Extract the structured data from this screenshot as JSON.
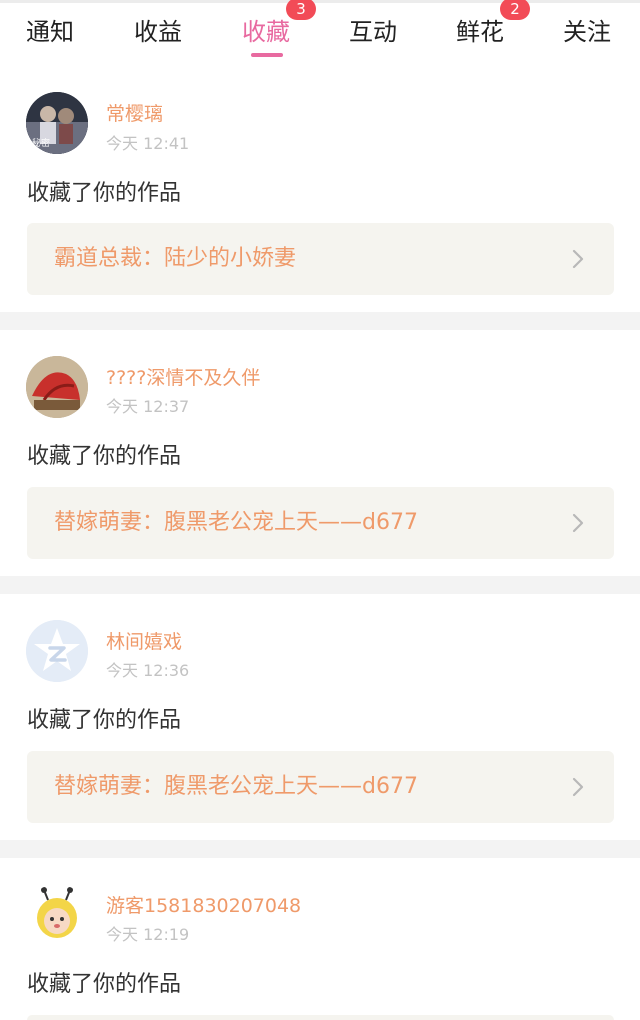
{
  "tabs": [
    {
      "label": "通知",
      "badge": null
    },
    {
      "label": "收益",
      "badge": null
    },
    {
      "label": "收藏",
      "badge": "3",
      "active": true
    },
    {
      "label": "互动",
      "badge": null
    },
    {
      "label": "鲜花",
      "badge": "2"
    },
    {
      "label": "关注",
      "badge": null
    }
  ],
  "accent_color": "#e86aa0",
  "badge_color": "#f24b57",
  "name_color": "#ef9a6a",
  "items": [
    {
      "username": "常樱璃",
      "time": "今天 12:41",
      "action": "收藏了你的作品",
      "work_title": "霸道总裁：陆少的小娇妻",
      "avatar_icon": "photo-avatar-icon"
    },
    {
      "username": "????深情不及久伴",
      "time": "今天 12:37",
      "action": "收藏了你的作品",
      "work_title": "替嫁萌妻：腹黑老公宠上天——d677",
      "avatar_icon": "photo-avatar-icon"
    },
    {
      "username": "林间嬉戏",
      "time": "今天 12:36",
      "action": "收藏了你的作品",
      "work_title": "替嫁萌妻：腹黑老公宠上天——d677",
      "avatar_icon": "default-star-avatar-icon"
    },
    {
      "username": "游客1581830207048",
      "time": "今天 12:19",
      "action": "收藏了你的作品",
      "avatar_icon": "cartoon-baby-avatar-icon"
    }
  ]
}
